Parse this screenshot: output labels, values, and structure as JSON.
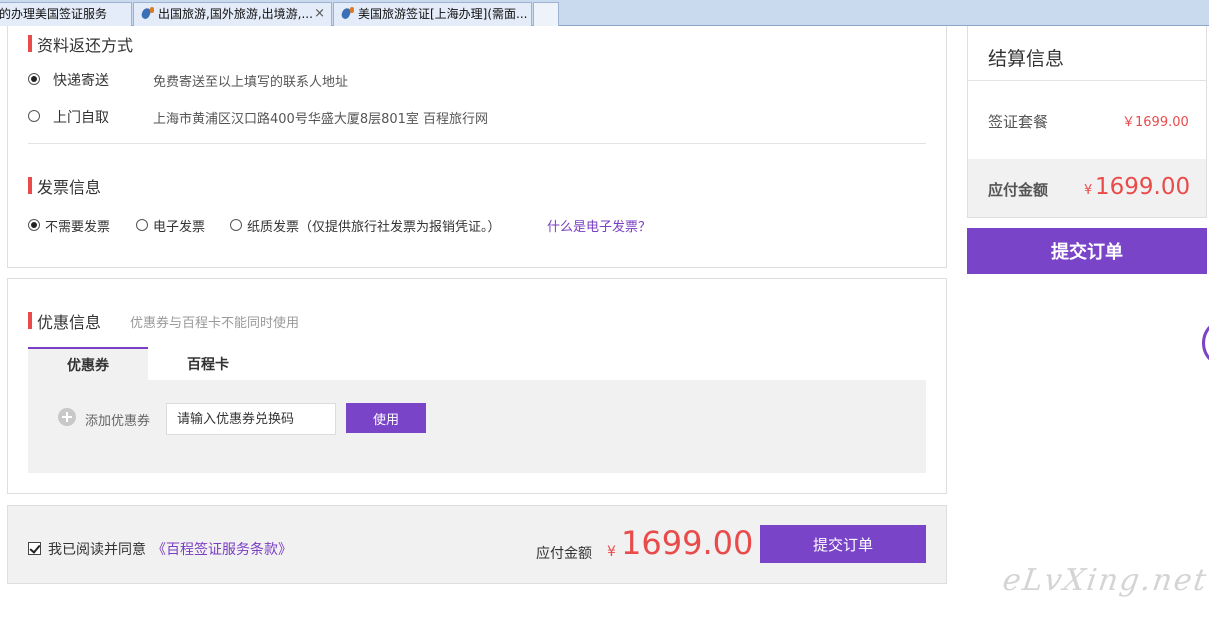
{
  "browser": {
    "tabs": [
      {
        "title": "的办理美国签证服务"
      },
      {
        "title": "出国旅游,国外旅游,出境游,...",
        "close": "×"
      },
      {
        "title": "美国旅游签证[上海办理](需面..."
      }
    ]
  },
  "return_method": {
    "title": "资料返还方式",
    "options": [
      {
        "label": "快递寄送",
        "desc": "免费寄送至以上填写的联系人地址",
        "selected": true
      },
      {
        "label": "上门自取",
        "desc": "上海市黄浦区汉口路400号华盛大厦8层801室 百程旅行网",
        "selected": false
      }
    ]
  },
  "invoice": {
    "title": "发票信息",
    "options": [
      {
        "label": "不需要发票",
        "selected": true
      },
      {
        "label": "电子发票",
        "selected": false
      },
      {
        "label": "纸质发票（仅提供旅行社发票为报销凭证。）",
        "selected": false
      }
    ],
    "help_link": "什么是电子发票？"
  },
  "discount": {
    "title": "优惠信息",
    "note": "优惠券与百程卡不能同时使用",
    "tabs": [
      "优惠券",
      "百程卡"
    ],
    "add_label": "添加优惠券",
    "input_placeholder": "请输入优惠券兑换码",
    "use_button": "使用"
  },
  "footer": {
    "agree_text": "我已阅读并同意",
    "terms_link": "《百程签证服务条款》",
    "payable_label": "应付金额",
    "currency": "¥",
    "amount": "1699.00",
    "submit_label": "提交订单"
  },
  "summary": {
    "title": "结算信息",
    "item_label": "签证套餐",
    "item_price": "￥1699.00",
    "total_label": "应付金额",
    "currency": "¥",
    "total_amount": "1699.00",
    "submit_label": "提交订单"
  },
  "watermark": "eLvXing.net",
  "colors": {
    "accent_purple": "#7a44c9",
    "price_red": "#e94b4b",
    "section_marker": "#e94b4b"
  }
}
